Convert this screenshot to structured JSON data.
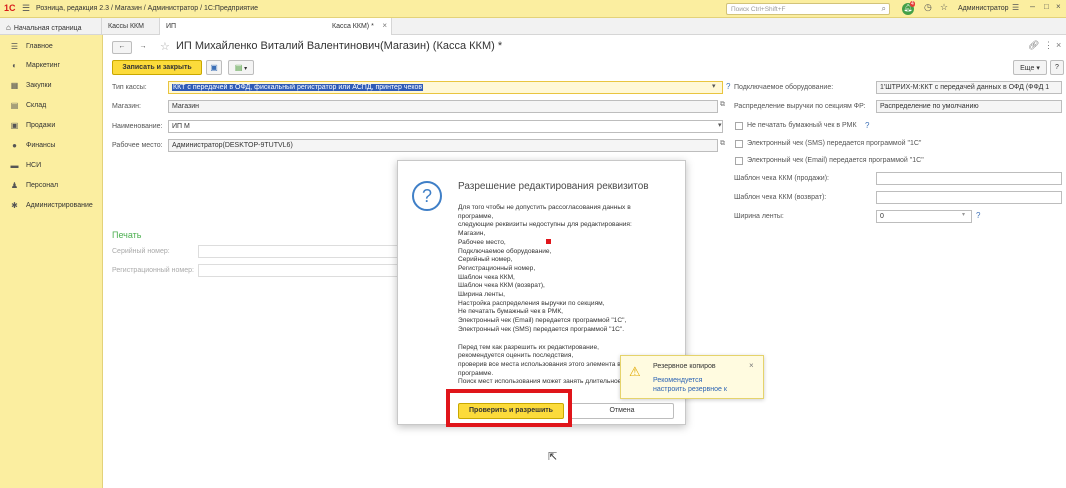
{
  "app": {
    "title": "Розница, редакция 2.3 / Магазин / Администратор / 1С:Предприятие",
    "logo": "1С",
    "search_placeholder": "Поиск Ctrl+Shift+F",
    "notifications_count": "4",
    "user": "Администратор"
  },
  "tabs": [
    {
      "label": "Начальная страница"
    },
    {
      "label": "Кассы ККМ"
    },
    {
      "label": "ИП"
    },
    {
      "label": "Касса ККМ) *"
    }
  ],
  "sidebar": {
    "items": [
      {
        "label": "Главное",
        "icon": "☰"
      },
      {
        "label": "Маркетинг",
        "icon": "◐"
      },
      {
        "label": "Закупки",
        "icon": "▦"
      },
      {
        "label": "Склад",
        "icon": "▤"
      },
      {
        "label": "Продажи",
        "icon": "▣"
      },
      {
        "label": "Финансы",
        "icon": "●"
      },
      {
        "label": "НСИ",
        "icon": "▬"
      },
      {
        "label": "Персонал",
        "icon": "♟"
      },
      {
        "label": "Администрирование",
        "icon": "✱"
      }
    ]
  },
  "form": {
    "title": "ИП Михайленко Виталий Валентинович(Магазин) (Касса ККМ) *",
    "save_close_label": "Записать и закрыть",
    "more_label": "Еще",
    "help_label": "?",
    "kassa_type_label": "Тип кассы:",
    "kassa_type_value": "ККТ с передачей в ОФД, фискальный регистратор или АСПД, принтер чеков",
    "store_label": "Магазин:",
    "store_value": "Магазин",
    "name_label": "Наименование:",
    "name_value": "ИП М",
    "workplace_label": "Рабочее место:",
    "workplace_value": "Администратор(DESKTOP-9TUTVL6)",
    "equipment_label": "Подключаемое оборудование:",
    "equipment_value": "1'ШТРИХ-М:ККТ с передачей данных в ОФД (ФФД 1",
    "distribution_label": "Распределение выручки по секциям ФР:",
    "distribution_value": "Распределение по умолчанию",
    "no_paper_label": "Не печатать бумажный чек в РМК",
    "sms_label": "Электронный чек (SMS) передается программой \"1С\"",
    "email_label": "Электронный чек (Email) передается программой \"1С\"",
    "template_sale_label": "Шаблон чека ККМ (продажи):",
    "template_return_label": "Шаблон чека ККМ (возврат):",
    "tape_width_label": "Ширина ленты:",
    "tape_width_value": "0",
    "print_section": "Печать",
    "serial_label": "Серийный номер:",
    "reg_label": "Регистрационный номер:"
  },
  "dialog": {
    "title": "Разрешение редактирования реквизитов",
    "intro": [
      "Для того чтобы не допустить рассогласования данных в",
      "программе,",
      "следующие реквизиты недоступны для редактирования:"
    ],
    "fields": [
      "Магазин,",
      "Рабочее место,",
      "Подключаемое оборудование,",
      "Серийный номер,",
      "Регистрационный номер,",
      "Шаблон чека ККМ,",
      "Шаблон чека ККМ (возврат),",
      "Ширина ленты,",
      "Настройка распределения выручки по секциям,",
      "Не печатать бумажный чек в РМК,",
      "Электронный чек (Email) передается программой \"1С\",",
      "Электронный чек (SMS) передается программой \"1С\"."
    ],
    "outro": [
      "Перед тем как разрешить их редактирование,",
      "рекомендуется оценить последствия,",
      "проверив все места использования этого элемента в",
      "программе.",
      "Поиск мест использования может занять длительное вре"
    ],
    "confirm_label": "Проверить и разрешить",
    "cancel_label": "Отмена"
  },
  "notification": {
    "title": "Резервное копиров",
    "line1": "Рекомендуется",
    "line2": "настроить резервное к",
    "close": "×"
  }
}
